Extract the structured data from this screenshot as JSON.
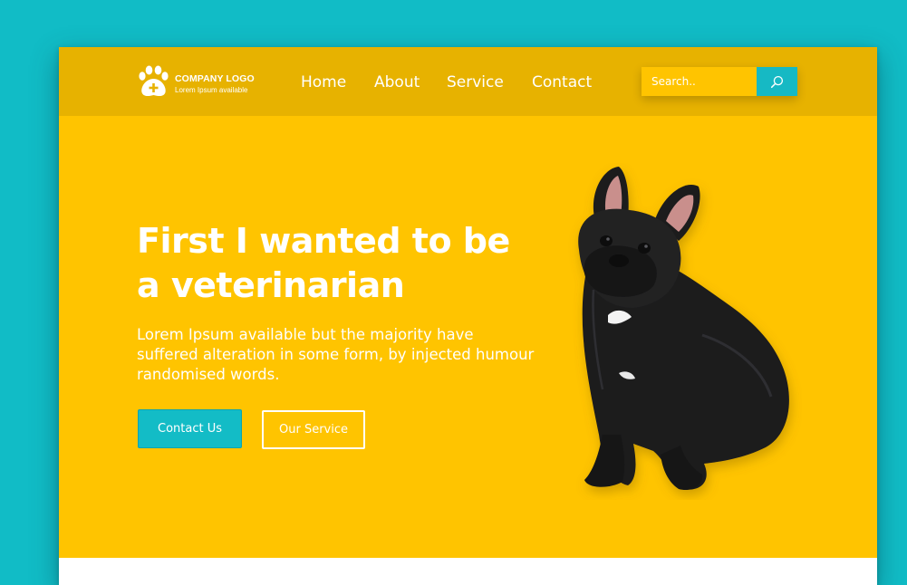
{
  "logo": {
    "title": "COMPANY LOGO",
    "tagline": "Lorem Ipsum available",
    "icon": "paw-plus-icon"
  },
  "nav": {
    "items": [
      {
        "label": "Home"
      },
      {
        "label": "About"
      },
      {
        "label": "Service"
      },
      {
        "label": "Contact"
      }
    ]
  },
  "search": {
    "placeholder": "Search..",
    "icon": "search-icon"
  },
  "hero": {
    "headline_line1": "First I wanted to be",
    "headline_line2": "a veterinarian",
    "description": "Lorem Ipsum available but the majority have suffered alteration in some form, by injected humour randomised words.",
    "primary_button": "Contact Us",
    "secondary_button": "Our Service",
    "image": "french-bulldog-photo"
  },
  "colors": {
    "backdrop": "#11bcc6",
    "hero_yellow": "#ffc400",
    "navbar_yellow": "#e7b200",
    "accent_teal": "#13bcc6",
    "text": "#ffffff"
  }
}
